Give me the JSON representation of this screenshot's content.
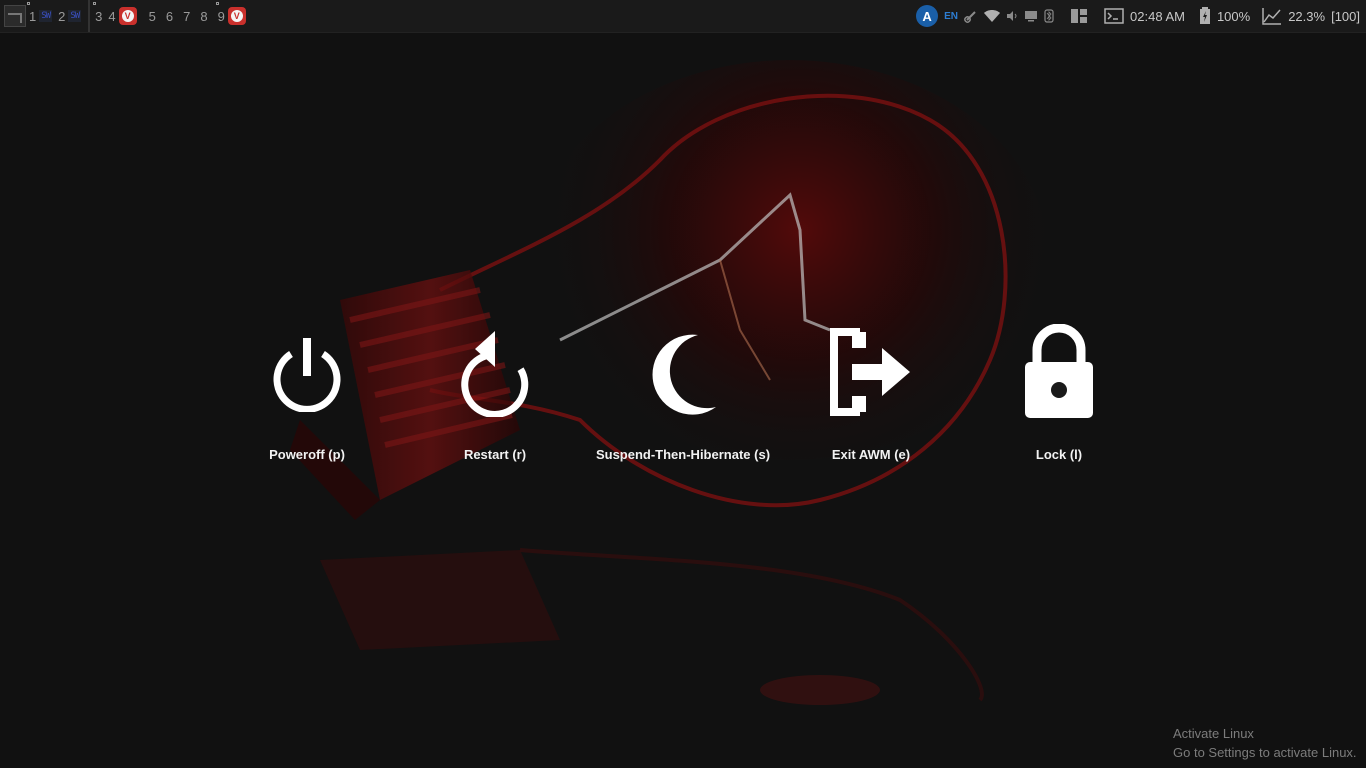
{
  "topbar": {
    "tags": [
      {
        "num": "1",
        "app": "SW"
      },
      {
        "num": "2",
        "app": "SW"
      },
      {
        "num": "3",
        "app": ""
      },
      {
        "num": "4",
        "app": "vivaldi"
      },
      {
        "num": "5",
        "app": ""
      },
      {
        "num": "6",
        "app": ""
      },
      {
        "num": "7",
        "app": ""
      },
      {
        "num": "8",
        "app": ""
      },
      {
        "num": "9",
        "app": "vivaldi"
      }
    ],
    "lang": "EN",
    "clock": "02:48 AM",
    "battery": "100%",
    "cpu": "22.3%",
    "volume": "[100]"
  },
  "menu": {
    "options": [
      {
        "label": "Poweroff (p)",
        "icon": "power-icon"
      },
      {
        "label": "Restart (r)",
        "icon": "restart-icon"
      },
      {
        "label": "Suspend-Then-Hibernate (s)",
        "icon": "moon-icon"
      },
      {
        "label": "Exit AWM (e)",
        "icon": "exit-icon"
      },
      {
        "label": "Lock (l)",
        "icon": "lock-icon"
      }
    ]
  },
  "watermark": {
    "line1": "Activate Linux",
    "line2": "Go to Settings to activate Linux."
  },
  "colors": {
    "background": "#111111",
    "bulb_glow": "#8a1010",
    "icon": "#ffffff"
  }
}
